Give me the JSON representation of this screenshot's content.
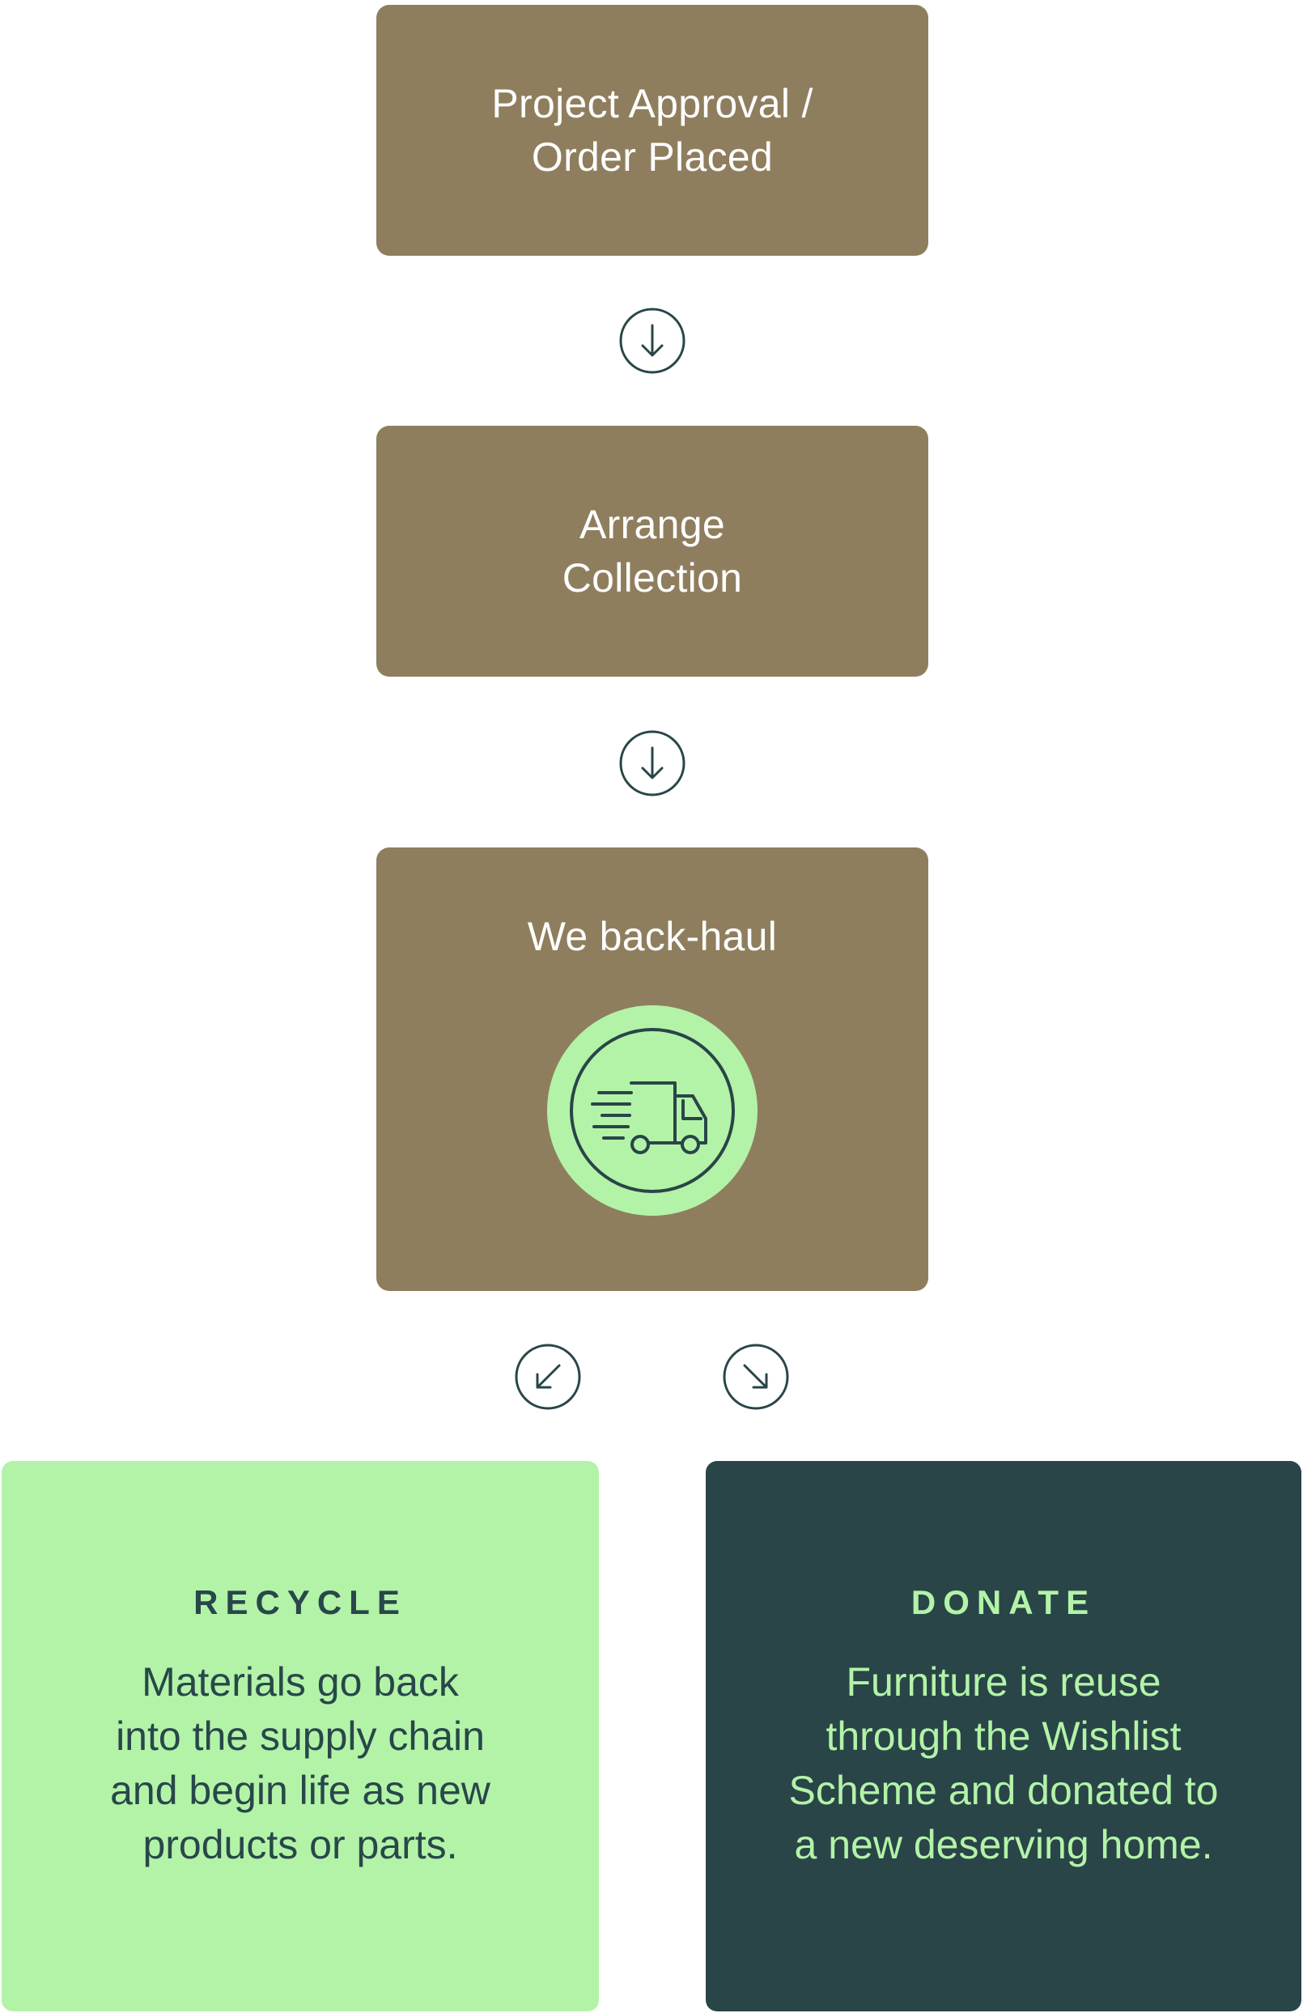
{
  "flow": {
    "steps": [
      {
        "lines": [
          "Project Approval /",
          "Order Placed"
        ]
      },
      {
        "lines": [
          "Arrange",
          "Collection"
        ]
      },
      {
        "lines": [
          "We back-haul"
        ],
        "icon": "delivery-truck-icon"
      }
    ],
    "arrows": [
      "arrow-down-icon",
      "arrow-down-icon",
      "arrow-down-left-icon",
      "arrow-down-right-icon"
    ]
  },
  "outcomes": {
    "recycle": {
      "heading": "RECYCLE",
      "lines": [
        "Materials go back",
        "into the supply chain",
        "and begin life as new",
        "products or parts."
      ]
    },
    "donate": {
      "heading": "DONATE",
      "lines": [
        "Furniture is reuse",
        "through the Wishlist",
        "Scheme and donated to",
        "a new deserving home."
      ]
    }
  },
  "colors": {
    "step_fill": "#8f7e5e",
    "light_green": "#b3f3a8",
    "dark_teal": "#294548",
    "icon_stroke": "#294548"
  }
}
